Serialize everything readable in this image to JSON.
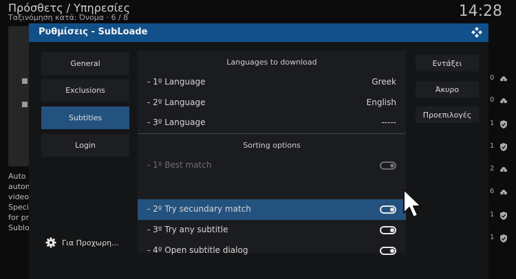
{
  "background": {
    "title": "Πρόσθετς / Υπηρεσίες",
    "sort_info": "Ταξινόμηση κατά: Όνομα  ·  6 / 8",
    "clock": "14:28",
    "description_lines": [
      "Auto ",
      "autom",
      "video",
      "Speci",
      "for pr",
      "Sublo"
    ],
    "right_list": [
      "0",
      "0",
      "1",
      "1",
      "2",
      "6",
      "1",
      "1"
    ],
    "icons": [
      "download-icon",
      "download-icon",
      "shield-check-icon",
      "shield-check-icon",
      "download-icon",
      "download-icon",
      "shield-check-icon",
      "shield-check-icon"
    ]
  },
  "dialog": {
    "title": "Ρυθμίσεις - SubLoade",
    "categories": [
      "General",
      "Exclusions",
      "Subtitles",
      "Login"
    ],
    "active_category": "Subtitles",
    "advanced_label": "Για Προχωρη...",
    "languages_header": "Languages to download",
    "languages": [
      {
        "label": "- 1º Language",
        "value": "Greek"
      },
      {
        "label": "- 2º Language",
        "value": "English"
      },
      {
        "label": "- 3º Language",
        "value": "-----"
      }
    ],
    "sorting_header": "Sorting options",
    "sorting": [
      {
        "label": "- 1º Best match",
        "on": true,
        "disabled": true
      },
      {
        "label": "- 2º Try secundary match",
        "on": true,
        "focused": true
      },
      {
        "label": "- 3º Try any subtitle",
        "on": true
      },
      {
        "label": "- 4º Open subtitle dialog",
        "on": true
      }
    ],
    "buttons": {
      "ok": "Εντάξει",
      "cancel": "Άκυρο",
      "defaults": "Προεπιλογές"
    }
  },
  "colors": {
    "header": "#12508a",
    "focus": "#24527f",
    "panel": "#1b1c1f"
  }
}
